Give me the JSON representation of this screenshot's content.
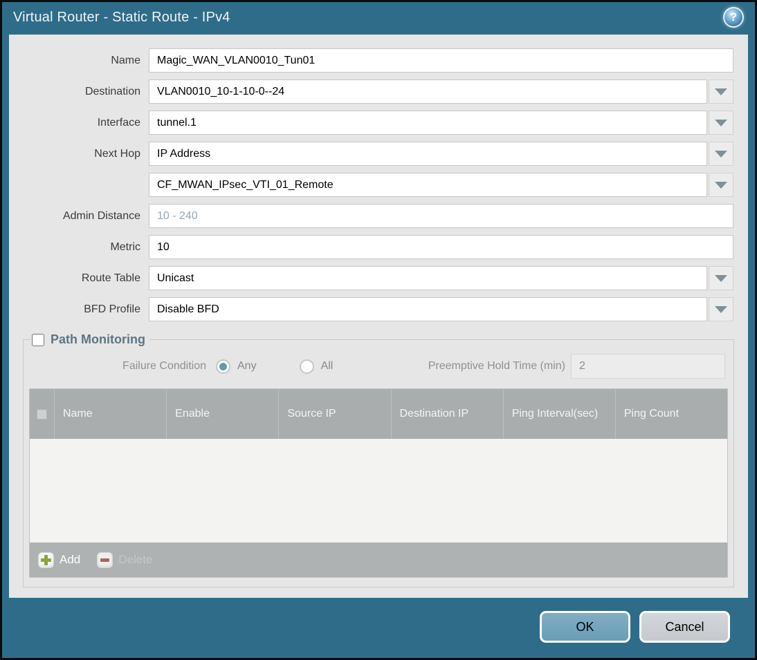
{
  "dialog": {
    "title": "Virtual Router - Static Route - IPv4",
    "help_icon_glyph": "?"
  },
  "form": {
    "fields": [
      {
        "label": "Name",
        "value": "Magic_WAN_VLAN0010_Tun01",
        "type": "text"
      },
      {
        "label": "Destination",
        "value": "VLAN0010_10-1-10-0--24",
        "type": "dropdown"
      },
      {
        "label": "Interface",
        "value": "tunnel.1",
        "type": "dropdown"
      },
      {
        "label": "Next Hop",
        "value": "IP Address",
        "type": "dropdown"
      },
      {
        "label": "",
        "value": "CF_MWAN_IPsec_VTI_01_Remote",
        "type": "dropdown"
      },
      {
        "label": "Admin Distance",
        "value": "",
        "placeholder": "10 - 240",
        "type": "text"
      },
      {
        "label": "Metric",
        "value": "10",
        "type": "text"
      },
      {
        "label": "Route Table",
        "value": "Unicast",
        "type": "dropdown"
      },
      {
        "label": "BFD Profile",
        "value": "Disable BFD",
        "type": "dropdown"
      }
    ]
  },
  "path_monitoring": {
    "legend": "Path Monitoring",
    "checkbox_checked": false,
    "failure_condition_label": "Failure Condition",
    "radio_any_label": "Any",
    "radio_all_label": "All",
    "radio_selected": "Any",
    "preemptive_label": "Preemptive Hold Time (min)",
    "preemptive_value": "2",
    "table": {
      "columns": [
        "Name",
        "Enable",
        "Source IP",
        "Destination IP",
        "Ping Interval(sec)",
        "Ping Count"
      ],
      "rows": [],
      "add_label": "Add",
      "delete_label": "Delete"
    }
  },
  "footer": {
    "ok_label": "OK",
    "cancel_label": "Cancel"
  },
  "colors": {
    "titlebar_teal": "#2f6c89",
    "content_bg": "#e6e6e6",
    "table_header_bg": "#a9adad",
    "ok_button_bg": "#74a5bd",
    "cancel_button_bg": "#ccd0d3",
    "add_icon_green": "#8da33e",
    "delete_icon_red": "#a5685e",
    "legend_text": "#5d7585"
  }
}
